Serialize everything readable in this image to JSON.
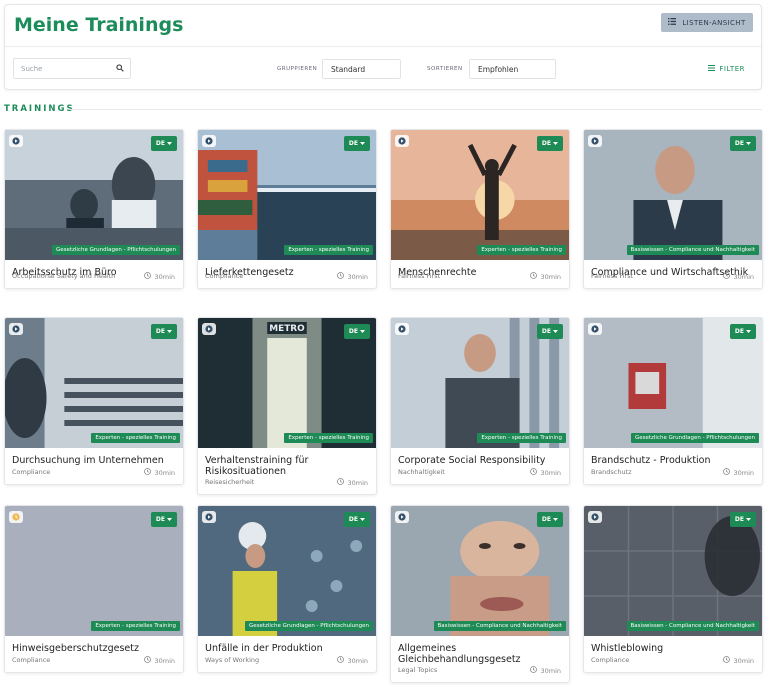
{
  "header": {
    "title": "Meine Trainings",
    "list_view_label": "LISTEN-ANSICHT",
    "search_placeholder": "Suche",
    "group_label": "GRUPPIEREN",
    "group_value": "Standard",
    "sort_label": "SORTIEREN",
    "sort_value": "Empfohlen",
    "filter_label": "FILTER"
  },
  "section": {
    "title": "TRAININGS"
  },
  "colors": {
    "accent": "#1d8c5b",
    "badge": "#1e8a55"
  },
  "cards": [
    {
      "title": "Arbeitsschutz im Büro",
      "subtitle": "Occupational Safety and Health",
      "duration": "30min",
      "lang": "DE",
      "badge": "Gesetzliche Grundlagen - Pflichtschulungen",
      "status_icon": "play-icon"
    },
    {
      "title": "Lieferkettengesetz",
      "subtitle": "Compliance",
      "duration": "30min",
      "lang": "DE",
      "badge": "Experten - spezielles Training",
      "status_icon": "play-icon"
    },
    {
      "title": "Menschenrechte",
      "subtitle": "Fairness First",
      "duration": "30min",
      "lang": "DE",
      "badge": "Experten - spezielles Training",
      "status_icon": "play-icon"
    },
    {
      "title": "Compliance und Wirtschaftsethik",
      "subtitle": "Fairness First",
      "duration": "30min",
      "lang": "DE",
      "badge": "Basiswissen - Compliance und Nachhaltigkeit",
      "status_icon": "play-icon"
    },
    {
      "title": "Durchsuchung im Unternehmen",
      "subtitle": "Compliance",
      "duration": "30min",
      "lang": "DE",
      "badge": "Experten - spezielles Training",
      "status_icon": "play-icon"
    },
    {
      "title": "Verhaltenstraining für Risikosituationen",
      "subtitle": "Reisesicherheit",
      "duration": "30min",
      "lang": "DE",
      "badge": "Experten - spezielles Training",
      "status_icon": "play-icon"
    },
    {
      "title": "Corporate Social Responsibility",
      "subtitle": "Nachhaltigkeit",
      "duration": "30min",
      "lang": "DE",
      "badge": "Experten - spezielles Training",
      "status_icon": "play-icon"
    },
    {
      "title": "Brandschutz - Produktion",
      "subtitle": "Brandschutz",
      "duration": "30min",
      "lang": "DE",
      "badge": "Gesetzliche Grundlagen - Pflichtschulungen",
      "status_icon": "play-icon"
    },
    {
      "title": "Hinweisgeberschutzgesetz",
      "subtitle": "Compliance",
      "duration": "30min",
      "lang": "DE",
      "badge": "Experten - spezielles Training",
      "status_icon": "pending-icon"
    },
    {
      "title": "Unfälle in der Produktion",
      "subtitle": "Ways of Working",
      "duration": "30min",
      "lang": "DE",
      "badge": "Gesetzliche Grundlagen - Pflichtschulungen",
      "status_icon": "play-icon"
    },
    {
      "title": "Allgemeines Gleichbehandlungsgesetz",
      "subtitle": "Legal Topics",
      "duration": "30min",
      "lang": "DE",
      "badge": "Basiswissen - Compliance und Nachhaltigkeit",
      "status_icon": "play-icon"
    },
    {
      "title": "Whistleblowing",
      "subtitle": "Compliance",
      "duration": "30min",
      "lang": "DE",
      "badge": "Basiswissen - Compliance und Nachhaltigkeit",
      "status_icon": "play-icon"
    }
  ]
}
